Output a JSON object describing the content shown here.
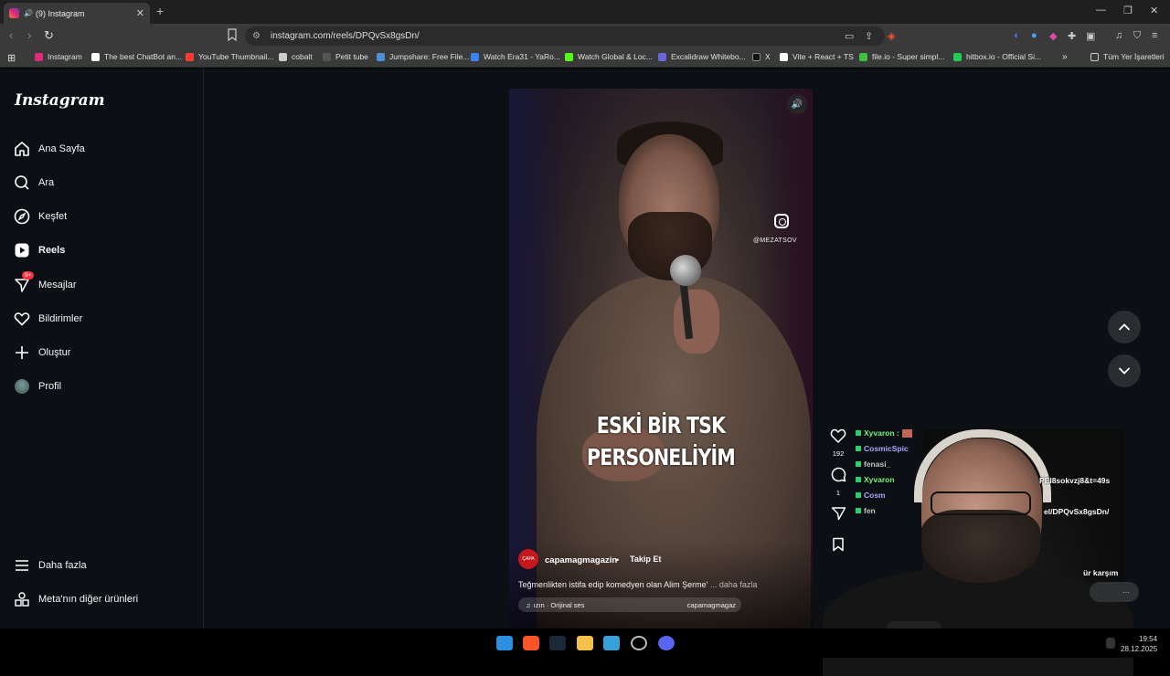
{
  "browser": {
    "tab_title": "(9) Instagram",
    "url": "instagram.com/reels/DPQvSx8gsDn/",
    "bookmarks": [
      {
        "label": "Instagram",
        "color": "#dd2a7b"
      },
      {
        "label": "The best ChatBot an...",
        "color": "#ffffff"
      },
      {
        "label": "YouTube Thumbnail...",
        "color": "#ff3b30"
      },
      {
        "label": "cobalt",
        "color": "#cccccc"
      },
      {
        "label": "Petit tube",
        "color": "#444444"
      },
      {
        "label": "Jumpshare: Free File...",
        "color": "#4a90d9"
      },
      {
        "label": "Watch Era31 - YaRo...",
        "color": "#3b82f6"
      },
      {
        "label": "Watch Global & Loc...",
        "color": "#53fc18"
      },
      {
        "label": "Excalidraw Whitebo...",
        "color": "#6965db"
      },
      {
        "label": "X",
        "color": "#000000"
      },
      {
        "label": "Vite + React + TS",
        "color": "#ffffff"
      },
      {
        "label": "file.io - Super simpl...",
        "color": "#3ec13e"
      },
      {
        "label": "hitbox.io - Official Si...",
        "color": "#22cc55"
      }
    ],
    "all_bookmarks": "Tüm Yer İşaretleri"
  },
  "instagram": {
    "logo": "Instagram",
    "nav": [
      {
        "label": "Ana Sayfa",
        "icon": "home-icon"
      },
      {
        "label": "Ara",
        "icon": "search-icon"
      },
      {
        "label": "Keşfet",
        "icon": "compass-icon"
      },
      {
        "label": "Reels",
        "icon": "reels-icon"
      },
      {
        "label": "Mesajlar",
        "icon": "messenger-icon",
        "badge": "9+"
      },
      {
        "label": "Bildirimler",
        "icon": "heart-icon"
      },
      {
        "label": "Oluştur",
        "icon": "plus-icon"
      },
      {
        "label": "Profil",
        "icon": "avatar-icon"
      }
    ],
    "more": "Daha fazla",
    "meta": "Meta'nın diğer ürünleri"
  },
  "reel": {
    "watermark_user": "@MEZATSOV",
    "caption_line1": "ESKİ BİR TSK",
    "caption_line2": "PERSONELİYİM",
    "account": "capamagmagazin",
    "follow": "Takip Et",
    "avatar_text": "ÇAPA",
    "description": "Teğmenlikten istifa edip komedyen olan Alim Şerme'",
    "more": "... daha fazla",
    "audio_left": "ızın · Orijinal ses",
    "audio_right": "capamagmagaz",
    "likes": "192",
    "comments": "1"
  },
  "overlay": {
    "chat": [
      {
        "name": "Xyvaron :",
        "color": "#7cf27c"
      },
      {
        "name": "CosmicSpic",
        "color": "#a8a8ff"
      },
      {
        "name": "fenasi_",
        "color": "#c0c0c0"
      },
      {
        "name": "Xyvaron",
        "color": "#7cf27c"
      },
      {
        "name": "Cosm",
        "color": "#a8a8ff"
      },
      {
        "name": "fen",
        "color": "#c0c0c0"
      }
    ],
    "link1": "PEI8sokvzj8&t=49s",
    "link2": "el/DPQvSx8gsDn/",
    "text3": "ür karşım"
  },
  "taskbar": {
    "time": "19:54",
    "date": "28.12.2025"
  }
}
